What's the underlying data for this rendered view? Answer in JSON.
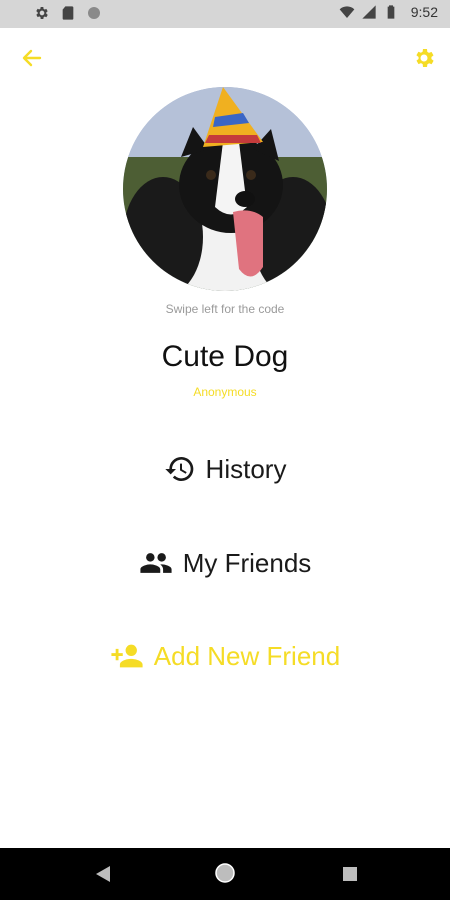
{
  "status_bar": {
    "time": "9:52",
    "icons": [
      "gear-icon",
      "sd-card-icon",
      "circle-icon",
      "wifi-icon",
      "signal-icon",
      "battery-icon"
    ]
  },
  "app_bar": {
    "back_icon": "arrow-left-icon",
    "settings_icon": "gear-icon"
  },
  "profile": {
    "swipe_hint": "Swipe left for the code",
    "name": "Cute Dog",
    "status": "Anonymous"
  },
  "menu": {
    "history_label": "History",
    "friends_label": "My Friends",
    "add_friend_label": "Add New Friend"
  },
  "colors": {
    "accent": "#f5dc26",
    "text": "#1a1a1a",
    "status_bar": "#d6d6d6",
    "nav_bar": "#000000"
  },
  "nav_bar": {
    "icons": [
      "nav-back-icon",
      "nav-home-icon",
      "nav-recents-icon"
    ]
  }
}
